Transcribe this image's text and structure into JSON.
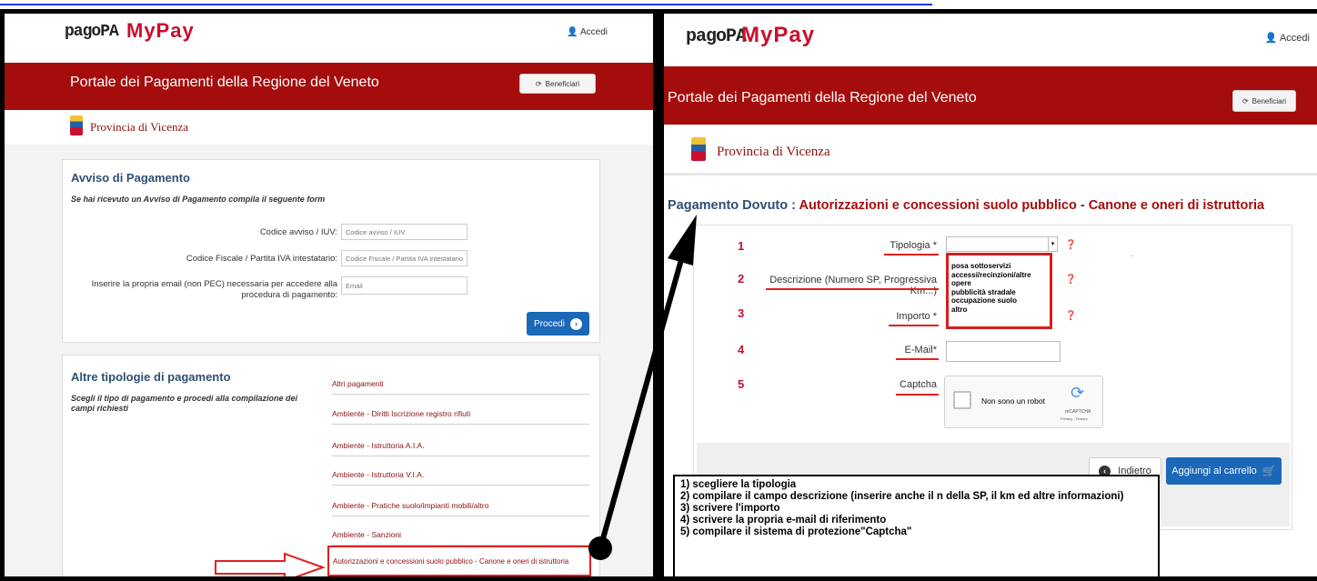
{
  "left": {
    "logo_pago": "pagoPA",
    "logo_my": "MyPay",
    "accedi": "Accedi",
    "portal_title": "Portale dei Pagamenti della Regione del Veneto",
    "beneficiari": "Beneficiari",
    "provincia": "Provincia di Vicenza",
    "avviso": {
      "title": "Avviso di Pagamento",
      "subtitle": "Se hai ricevuto un Avviso di Pagamento compila il seguente form",
      "fields": [
        {
          "label": "Codice avviso / IUV:",
          "placeholder": "Codice avviso / IUV"
        },
        {
          "label": "Codice Fiscale / Partita IVA intestatario:",
          "placeholder": "Codice Fiscale / Partita IVA intestatario"
        },
        {
          "label": "Inserire la propria email (non PEC) necessaria per accedere alla procedura di pagamento:",
          "placeholder": "Email"
        }
      ],
      "procedi": "Procedi"
    },
    "altre": {
      "title": "Altre tipologie di pagamento",
      "subtitle": "Scegli il tipo di pagamento e procedi alla compilazione dei campi richiesti",
      "items": [
        "Altri pagamenti",
        "Ambiente - Diritti Iscrizione registro rifiuti",
        "Ambiente - Istruttoria A.I.A.",
        "Ambiente - Istruttoria V.I.A.",
        "Ambiente - Pratiche suolo/impianti mobili/altro",
        "Ambiente - Sanzioni",
        "Autorizzazioni e concessioni suolo pubblico - Canone e oneri di istruttoria"
      ]
    }
  },
  "right": {
    "logo_pago": "pagoPA",
    "logo_my": "MyPay",
    "accedi": "Accedi",
    "portal_title": "Portale dei Pagamenti della Regione del Veneto",
    "beneficiari": "Beneficiari",
    "provincia": "Provincia di Vicenza",
    "heading_prefix": "Pagamento Dovuto : ",
    "heading_main": "Autorizzazioni e concessioni suolo pubblico - Canone e oneri di istruttoria",
    "rows": [
      {
        "num": "1",
        "label": "Tipologia *"
      },
      {
        "num": "2",
        "label": "Descrizione (Numero SP, Progressiva Km...)"
      },
      {
        "num": "3",
        "label": "Importo *"
      },
      {
        "num": "4",
        "label": "E-Mail*"
      },
      {
        "num": "5",
        "label": "Captcha"
      }
    ],
    "tipologia_options": [
      "posa sottoservizi",
      "accessi/recinzioni/altre opere",
      "pubblicità stradale",
      "occupazione suolo",
      "altro"
    ],
    "captcha": {
      "text": "Non sono un robot",
      "brand": "reCAPTCHA",
      "links": "Privacy - Termini"
    },
    "indietro": "Indietro",
    "aggiungi": "Aggiungi al carrello",
    "notes": [
      "1)  scegliere la tipologia",
      "2)  compilare il campo descrizione (inserire anche il n della SP, il km ed altre informazioni)",
      "3)  scrivere l'importo",
      "4)  scrivere la propria e-mail di riferimento",
      "5)  compilare il sistema di protezione\"Captcha\""
    ]
  }
}
